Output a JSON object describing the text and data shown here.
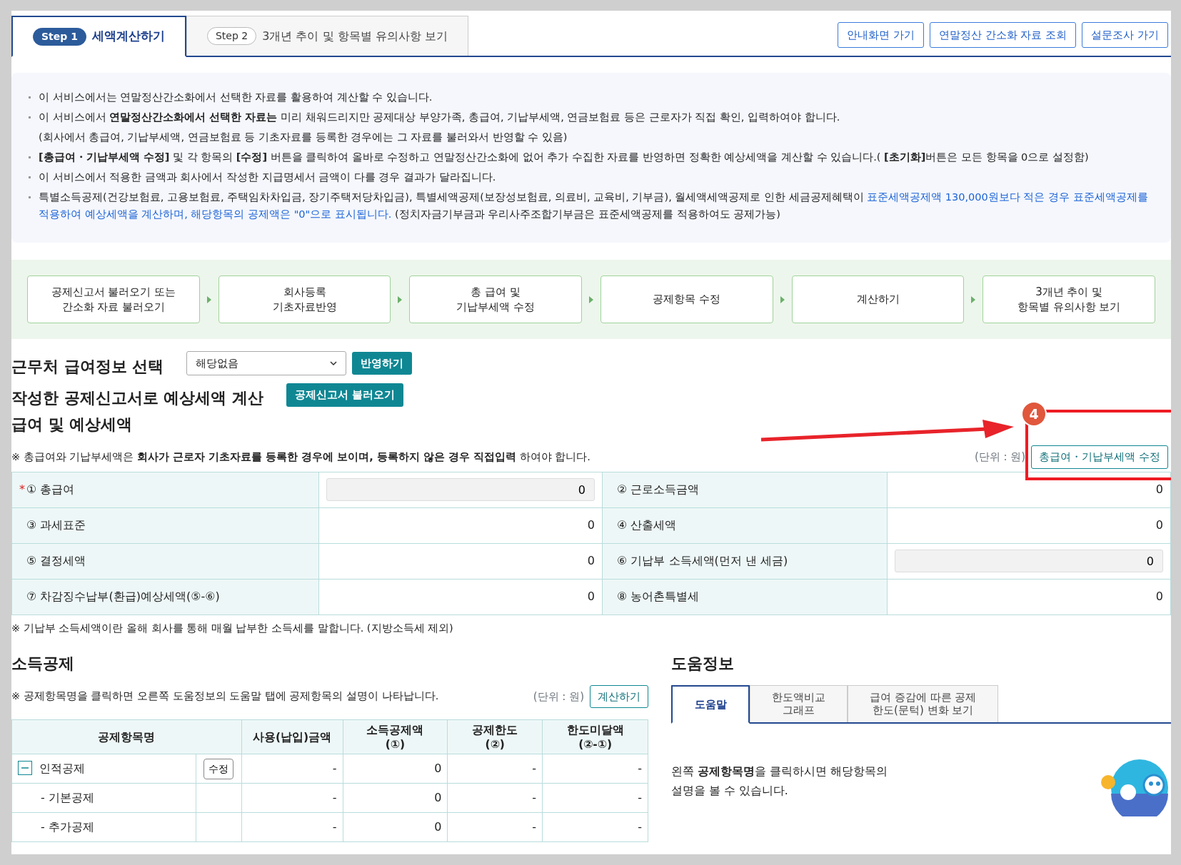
{
  "tabs": [
    {
      "step": "Step 1",
      "label": "세액계산하기",
      "selected": true
    },
    {
      "step": "Step 2",
      "label": "3개년 추이 및 항목별 유의사항 보기",
      "selected": false
    }
  ],
  "top_buttons": [
    "안내화면 가기",
    "연말정산 간소화 자료 조회",
    "설문조사 가기"
  ],
  "notices": [
    {
      "segments": [
        {
          "kind": "plain",
          "text": "이 서비스에서는 연말정산간소화에서 선택한 자료를 활용하여 계산할 수 있습니다."
        }
      ]
    },
    {
      "segments": [
        {
          "kind": "plain",
          "text": "이 서비스에서 **연말정산간소화에서 선택한 자료는** 미리 채워드리지만 공제대상 부양가족, 총급여, 기납부세액, 연금보험료 등은 근로자가 직접 확인, 입력하여야 합니다."
        }
      ],
      "sub": "(회사에서 총급여, 기납부세액, 연금보험료 등 기초자료를 등록한 경우에는 그 자료를 불러와서 반영할 수 있음)"
    },
    {
      "segments": [
        {
          "kind": "plain",
          "text": "**[총급여・기납부세액 수정]**  및 각 항목의 **[수정]** 버튼을 클릭하여 올바로 수정하고 연말정산간소화에 없어 추가 수집한 자료를 반영하면 정확한 예상세액을 계산할 수 있습니다.( **[초기화]**버튼은 모든 항목을 0으로 설정함)"
        }
      ]
    },
    {
      "segments": [
        {
          "kind": "plain",
          "text": "이 서비스에서 적용한 금액과 회사에서 작성한 지급명세서 금액이 다를 경우 결과가 달라집니다."
        }
      ]
    },
    {
      "segments": [
        {
          "kind": "plain",
          "text": "특별소득공제(건강보험료, 고용보험료, 주택임차차입금, 장기주택저당차입금), 특별세액공제(보장성보험료, 의료비, 교육비, 기부금), 월세액세액공제로 인한 세금공제혜택이 "
        },
        {
          "kind": "blue",
          "text": "표준세액공제액 130,000원보다 적은 경우 표준세액공제를 적용하여 예상세액을 계산하며, 해당항목의 공제액은 \"0\"으로 표시됩니다."
        },
        {
          "kind": "plain",
          "text": " (정치자금기부금과 우리사주조합기부금은 표준세액공제를 적용하여도 공제가능)"
        }
      ]
    }
  ],
  "flow_steps": [
    [
      "공제신고서 불러오기 또는",
      "간소화 자료 불러오기"
    ],
    [
      "회사등록",
      "기초자료반영"
    ],
    [
      "총 급여 및",
      "기납부세액 수정"
    ],
    [
      "공제항목 수정"
    ],
    [
      "계산하기"
    ],
    [
      "3개년 추이 및",
      "항목별 유의사항 보기"
    ]
  ],
  "workplace": {
    "label": "근무처 급여정보 선택",
    "select_value": "해당없음",
    "button": "반영하기"
  },
  "declaration": {
    "label": "작성한 공제신고서로 예상세액 계산",
    "button": "공제신고서 불러오기"
  },
  "salary": {
    "title": "급여 및 예상세액",
    "note": "※ 총급여와 기납부세액은 **회사가 근로자 기초자료를 등록한 경우에 보이며, 등록하지 않은 경우 직접입력** 하여야 합니다.",
    "unit": "(단위 : 원)",
    "edit_button": "총급여・기납부세액 수정",
    "rows": [
      [
        {
          "label": "① 총급여",
          "required_mark": "*",
          "kind": "input",
          "value": "0"
        },
        {
          "label": "② 근로소득금액",
          "kind": "text",
          "value": "0"
        }
      ],
      [
        {
          "label": "③ 과세표준",
          "kind": "text",
          "value": "0"
        },
        {
          "label": "④ 산출세액",
          "kind": "text",
          "value": "0"
        }
      ],
      [
        {
          "label": "⑤ 결정세액",
          "kind": "text",
          "value": "0"
        },
        {
          "label": "⑥ 기납부 소득세액(먼저 낸 세금)",
          "kind": "input",
          "value": "0"
        }
      ],
      [
        {
          "label": "⑦ 차감징수납부(환급)예상세액(⑤-⑥)",
          "kind": "text",
          "value": "0"
        },
        {
          "label": "⑧ 농어촌특별세",
          "kind": "text",
          "value": "0"
        }
      ]
    ],
    "footnote": "※ 기납부 소득세액이란 올해 회사를 통해 매월 납부한 소득세를 말합니다. (지방소득세 제외)"
  },
  "deduction": {
    "title": "소득공제",
    "note": "※ 공제항목명을 클릭하면 오른쪽 도움정보의 도움말 탭에 공제항목의 설명이 나타납니다.",
    "unit": "(단위 : 원)",
    "button": "계산하기",
    "columns": [
      "공제항목명",
      "사용(납입)금액",
      "소득공제액\n(①)",
      "공제한도\n(②)",
      "한도미달액\n(②-①)"
    ],
    "rows": [
      {
        "expanded": true,
        "edit_button": "수정",
        "cells": [
          "인적공제",
          "-",
          "0",
          "-",
          "-"
        ],
        "children": [
          {
            "cells": [
              "- 기본공제",
              "-",
              "0",
              "-",
              "-"
            ]
          },
          {
            "cells": [
              "- 추가공제",
              "-",
              "0",
              "-",
              "-"
            ]
          }
        ]
      }
    ]
  },
  "help": {
    "title": "도움정보",
    "tabs": [
      {
        "lines": [
          "도움말"
        ],
        "selected": true
      },
      {
        "lines": [
          "한도액비교",
          "그래프"
        ],
        "selected": false
      },
      {
        "lines": [
          "급여 증감에 따른 공제",
          "한도(문턱) 변화 보기"
        ],
        "selected": false
      }
    ],
    "text_lines": [
      "왼쪽 **공제항목명**을 클릭하시면 해당항목의",
      "설명을 볼 수 있습니다."
    ]
  },
  "annotation": {
    "badge": "4"
  }
}
